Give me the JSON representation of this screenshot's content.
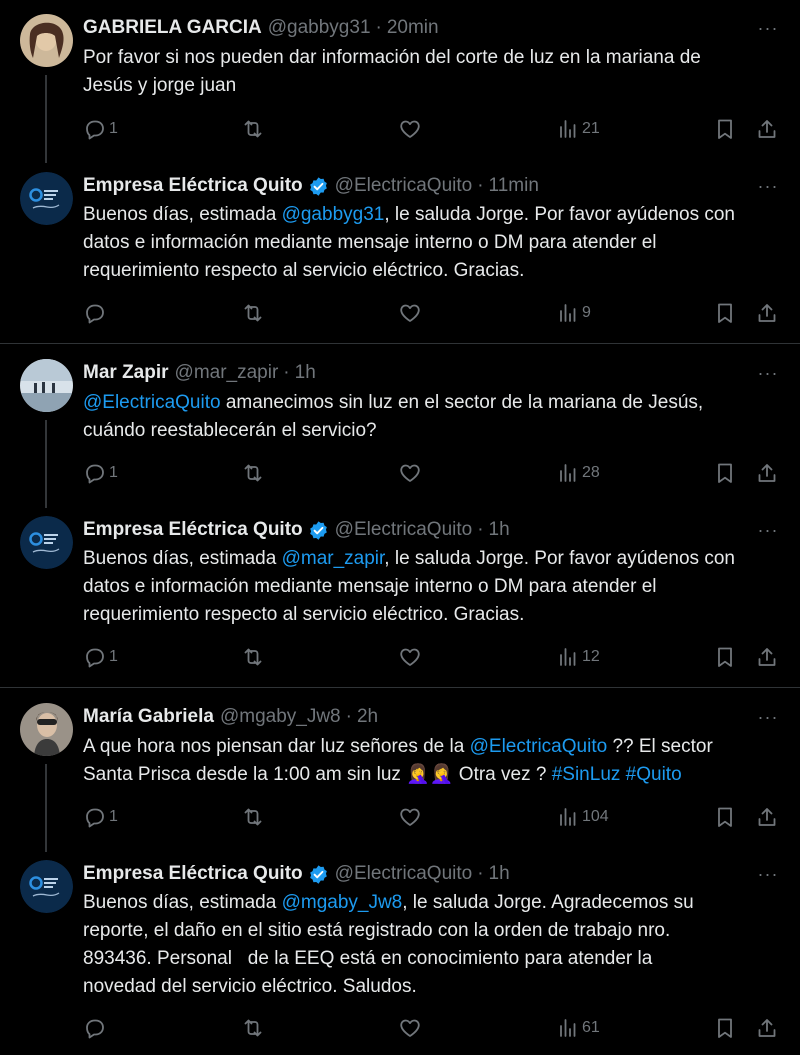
{
  "threads": [
    {
      "question": {
        "name": "GABRIELA GARCIA",
        "handle": "@gabbyg31",
        "time": "20min",
        "text": "Por favor si nos pueden dar información del corte de luz en la mariana de\nJesús y jorge juan",
        "replies": "1",
        "views": "21"
      },
      "answer": {
        "name": "Empresa Eléctrica Quito",
        "handle": "@ElectricaQuito",
        "time": "11min",
        "pre": "Buenos días, estimada ",
        "mention": "@gabbyg31",
        "post": ", le saluda Jorge. Por favor ayúdenos con\ndatos e información mediante mensaje interno o DM para atender el\nrequerimiento respecto al servicio eléctrico. Gracias.",
        "replies": "",
        "views": "9"
      }
    },
    {
      "question": {
        "name": "Mar Zapir",
        "handle": "@mar_zapir",
        "time": "1h",
        "mention": "@ElectricaQuito",
        "text": " amanecimos sin luz en el sector de la mariana de Jesús,\ncuándo reestablecerán el servicio?",
        "replies": "1",
        "views": "28"
      },
      "answer": {
        "name": "Empresa Eléctrica Quito",
        "handle": "@ElectricaQuito",
        "time": "1h",
        "pre": "Buenos días, estimada ",
        "mention": "@mar_zapir",
        "post": ", le saluda Jorge. Por favor ayúdenos con\ndatos e información mediante mensaje interno o DM para atender el\nrequerimiento respecto al servicio eléctrico. Gracias.",
        "replies": "1",
        "views": "12"
      }
    },
    {
      "question": {
        "name": "María Gabriela",
        "handle": "@mgaby_Jw8",
        "time": "2h",
        "pre": "A que hora nos piensan dar luz señores de la ",
        "mention": "@ElectricaQuito",
        "mid": " ?? El sector\nSanta Prisca desde la 1:00 am sin luz ",
        "emoji": "🤦‍♀️🤦‍♀️",
        "mid2": " Otra vez ? ",
        "tag1": "#SinLuz",
        "tag2": "#Quito",
        "replies": "1",
        "views": "104"
      },
      "answer": {
        "name": "Empresa Eléctrica Quito",
        "handle": "@ElectricaQuito",
        "time": "1h",
        "pre": "Buenos días, estimada ",
        "mention": "@mgaby_Jw8",
        "post": ", le saluda Jorge. Agradecemos su\nreporte, el daño en el sitio está registrado con la orden de trabajo nro.\n893436. Personal   de la EEQ está en conocimiento para atender la\nnovedad del servicio eléctrico. Saludos.",
        "replies": "",
        "views": "61"
      }
    }
  ],
  "ui": {
    "separator_dot": "·",
    "more_glyph": "···",
    "accent_color": "#1d9bf0",
    "muted_color": "#71767b",
    "background": "#000000"
  }
}
